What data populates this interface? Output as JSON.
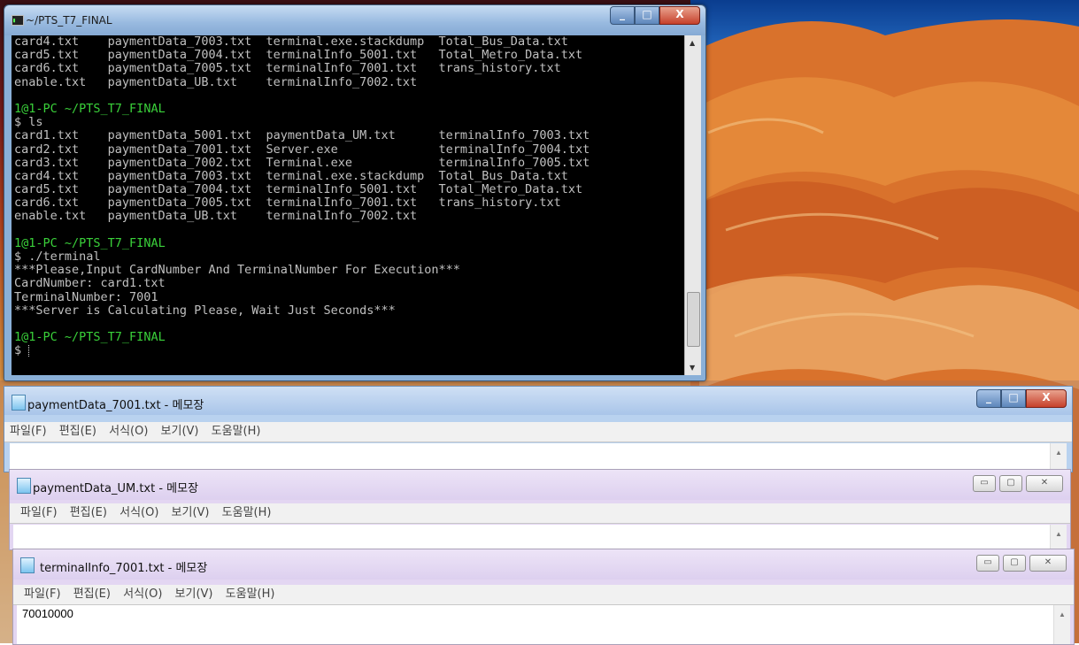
{
  "terminal": {
    "title": "~/PTS_T7_FINAL",
    "controls": {
      "minimize": "_",
      "maximize": "□",
      "close": "X"
    },
    "lines": [
      {
        "text": "card4.txt    paymentData_7003.txt  terminal.exe.stackdump  Total_Bus_Data.txt",
        "style": ""
      },
      {
        "text": "card5.txt    paymentData_7004.txt  terminalInfo_5001.txt   Total_Metro_Data.txt",
        "style": ""
      },
      {
        "text": "card6.txt    paymentData_7005.txt  terminalInfo_7001.txt   trans_history.txt",
        "style": ""
      },
      {
        "text": "enable.txt   paymentData_UB.txt    terminalInfo_7002.txt",
        "style": ""
      },
      {
        "text": "",
        "style": ""
      },
      {
        "text": "1@1-PC ~/PTS_T7_FINAL",
        "style": "prompt"
      },
      {
        "text": "$ ls",
        "style": ""
      },
      {
        "text": "card1.txt    paymentData_5001.txt  paymentData_UM.txt      terminalInfo_7003.txt",
        "style": ""
      },
      {
        "text": "card2.txt    paymentData_7001.txt  Server.exe              terminalInfo_7004.txt",
        "style": ""
      },
      {
        "text": "card3.txt    paymentData_7002.txt  Terminal.exe            terminalInfo_7005.txt",
        "style": ""
      },
      {
        "text": "card4.txt    paymentData_7003.txt  terminal.exe.stackdump  Total_Bus_Data.txt",
        "style": ""
      },
      {
        "text": "card5.txt    paymentData_7004.txt  terminalInfo_5001.txt   Total_Metro_Data.txt",
        "style": ""
      },
      {
        "text": "card6.txt    paymentData_7005.txt  terminalInfo_7001.txt   trans_history.txt",
        "style": ""
      },
      {
        "text": "enable.txt   paymentData_UB.txt    terminalInfo_7002.txt",
        "style": ""
      },
      {
        "text": "",
        "style": ""
      },
      {
        "text": "1@1-PC ~/PTS_T7_FINAL",
        "style": "prompt"
      },
      {
        "text": "$ ./terminal",
        "style": ""
      },
      {
        "text": "***Please,Input CardNumber And TerminalNumber For Execution***",
        "style": ""
      },
      {
        "text": "CardNumber: card1.txt",
        "style": ""
      },
      {
        "text": "TerminalNumber: 7001",
        "style": ""
      },
      {
        "text": "***Server is Calculating Please, Wait Just Seconds***",
        "style": ""
      },
      {
        "text": "",
        "style": ""
      },
      {
        "text": "1@1-PC ~/PTS_T7_FINAL",
        "style": "prompt"
      },
      {
        "text": "$ ",
        "style": ""
      }
    ]
  },
  "notepads": [
    {
      "title": "paymentData_7001.txt - 메모장",
      "menu": [
        "파일(F)",
        "편집(E)",
        "서식(O)",
        "보기(V)",
        "도움말(H)"
      ],
      "content": "",
      "active": true
    },
    {
      "title": "paymentData_UM.txt - 메모장",
      "menu": [
        "파일(F)",
        "편집(E)",
        "서식(O)",
        "보기(V)",
        "도움말(H)"
      ],
      "content": "",
      "active": false
    },
    {
      "title": "terminalInfo_7001.txt - 메모장",
      "menu": [
        "파일(F)",
        "편집(E)",
        "서식(O)",
        "보기(V)",
        "도움말(H)"
      ],
      "content": "70010000",
      "active": false
    }
  ]
}
